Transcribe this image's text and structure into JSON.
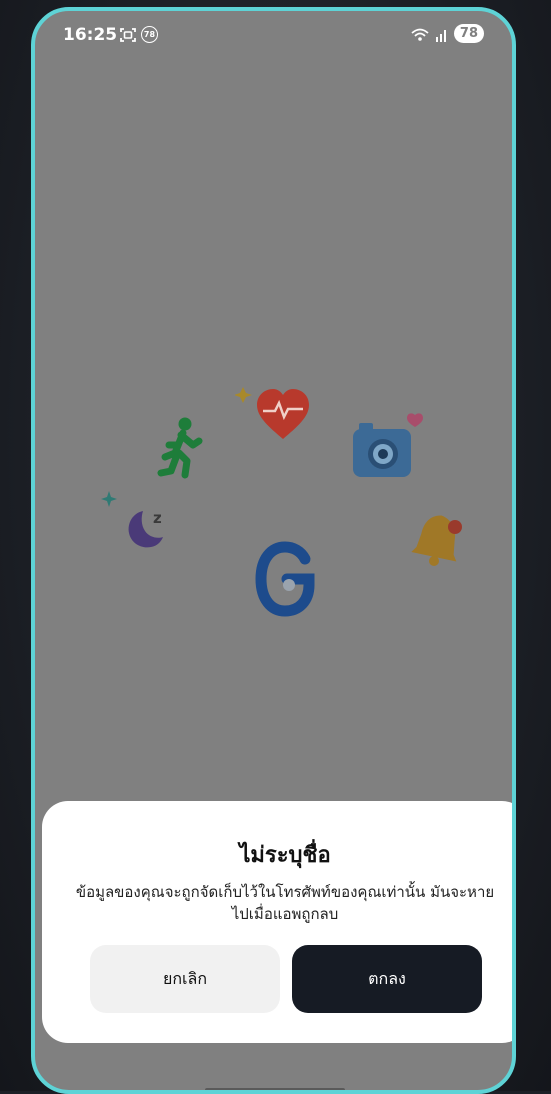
{
  "status_bar": {
    "time": "16:25",
    "notification_badge": "78",
    "battery": "78"
  },
  "illustration": {
    "icons": [
      "walking-person-icon",
      "heart-rate-icon",
      "camera-icon",
      "sleep-moon-icon",
      "bell-icon",
      "g-logo-icon"
    ],
    "logo_letter": "G"
  },
  "dialog": {
    "title": "ไม่ระบุชื่อ",
    "message": "ข้อมูลของคุณจะถูกจัดเก็บไว้ในโทรศัพท์ของคุณเท่านั้น มันจะหายไปเมื่อแอพถูกลบ",
    "cancel_label": "ยกเลิก",
    "ok_label": "ตกลง"
  },
  "colors": {
    "accent_border": "#5ed3d6",
    "overlay": "#808080",
    "ok_button": "#161b24",
    "cancel_button": "#f1f1f1"
  }
}
